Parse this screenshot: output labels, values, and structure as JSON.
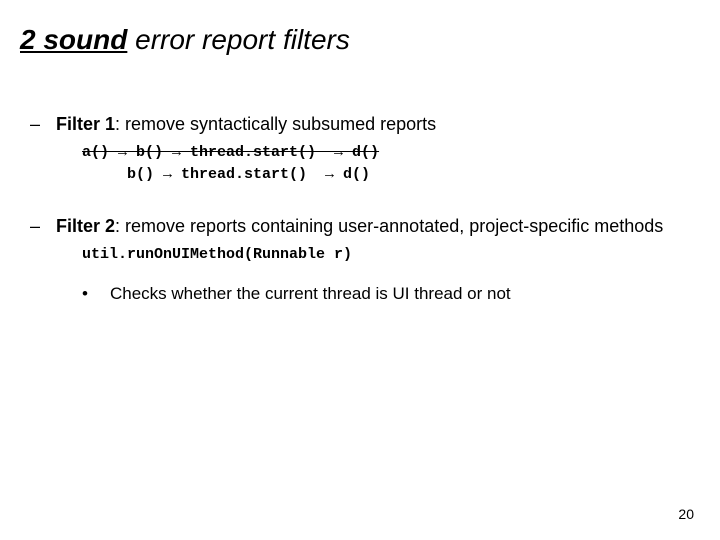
{
  "title": {
    "emph": "2 sound",
    "rest": " error report filters"
  },
  "filter1": {
    "label": "Filter 1",
    "desc": ": remove syntactically subsumed reports",
    "code_struck": "a() → b() → thread.start()  → d()",
    "code_kept": "     b() → thread.start()  → d()"
  },
  "filter2": {
    "label": "Filter 2",
    "desc": ": remove reports containing user-annotated, project-specific methods",
    "code": "util.runOnUIMethod(Runnable r)",
    "sub_bullet": "Checks whether the current thread is UI thread or not"
  },
  "page_number": "20"
}
